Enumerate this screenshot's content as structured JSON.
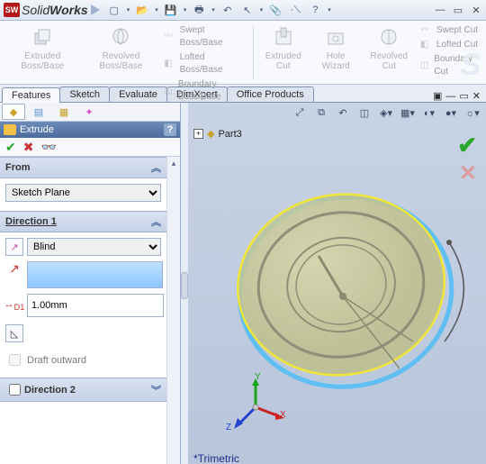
{
  "app": {
    "logo_text": "SW",
    "title": "SolidWorks"
  },
  "qat_icons": [
    "new",
    "open",
    "save",
    "print",
    "rebuild",
    "options",
    "undo",
    "select",
    "pin",
    "thickness",
    "help"
  ],
  "window_controls": [
    "min",
    "restore",
    "close"
  ],
  "ribbon": {
    "big": [
      "Extruded Boss/Base",
      "Revolved Boss/Base"
    ],
    "group1": [
      "Swept Boss/Base",
      "Lofted Boss/Base",
      "Boundary Boss/Base"
    ],
    "big2": [
      "Extruded Cut",
      "Hole Wizard",
      "Revolved Cut"
    ],
    "group2": [
      "Swept Cut",
      "Lofted Cut",
      "Boundary Cut"
    ]
  },
  "tabs": {
    "items": [
      "Features",
      "Sketch",
      "Evaluate",
      "DimXpert",
      "Office Products"
    ],
    "active": 0
  },
  "fm_tabs": [
    "feature-tree",
    "property-mgr",
    "config-mgr",
    "dim-mgr"
  ],
  "pm": {
    "title": "Extrude",
    "help": "?",
    "action_icons": {
      "ok": "✔",
      "cancel": "✖",
      "detail": "👓"
    },
    "from": {
      "label": "From",
      "value": "Sketch Plane"
    },
    "dir1": {
      "label": "Direction 1",
      "end_condition": "Blind",
      "depth": "1.00mm",
      "draft": "Draft outward"
    },
    "dir2": {
      "label": "Direction 2"
    }
  },
  "viewport": {
    "part_name": "Part3",
    "view_label": "*Trimetric",
    "axes": {
      "x": "X",
      "y": "Y",
      "z": "Z"
    },
    "toolbar_icons": [
      "zoom-fit",
      "zoom-area",
      "prev-view",
      "section",
      "view-orient",
      "display-style",
      "hide-show",
      "edit-appearance",
      "scene",
      "view-settings"
    ]
  }
}
